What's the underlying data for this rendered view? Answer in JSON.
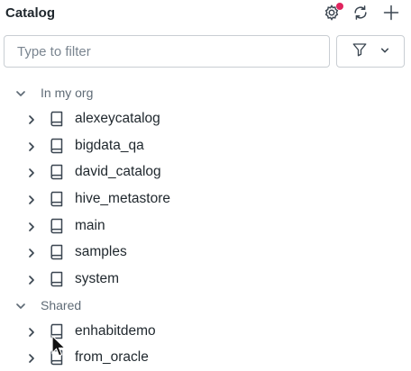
{
  "header": {
    "title": "Catalog",
    "icons": [
      "gear-icon",
      "refresh-icon",
      "plus-icon"
    ],
    "notification_dot_color": "#e0245e"
  },
  "filter": {
    "placeholder": "Type to filter",
    "value": "",
    "filter_icon": "funnel-icon",
    "dropdown_icon": "chevron-down-icon"
  },
  "tree": {
    "groups": [
      {
        "label": "In my org",
        "expanded": true,
        "items": [
          "alexeycatalog",
          "bigdata_qa",
          "david_catalog",
          "hive_metastore",
          "main",
          "samples",
          "system"
        ]
      },
      {
        "label": "Shared",
        "expanded": true,
        "items": [
          "enhabitdemo",
          "from_oracle"
        ]
      }
    ],
    "item_icon": "book-icon",
    "collapsed_icon": "chevron-right-icon"
  },
  "colors": {
    "text": "#1f272d",
    "muted": "#5f6b76",
    "border": "#c9ced3"
  }
}
